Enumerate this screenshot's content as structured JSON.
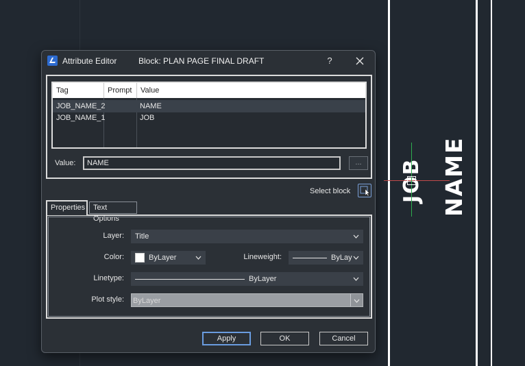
{
  "dialog": {
    "title": "Attribute Editor",
    "block_label": "Block: PLAN PAGE FINAL DRAFT",
    "help_label": "?"
  },
  "table": {
    "headers": {
      "tag": "Tag",
      "prompt": "Prompt",
      "value": "Value"
    },
    "rows": [
      {
        "tag": "JOB_NAME_2",
        "prompt": "",
        "value": "NAME"
      },
      {
        "tag": "JOB_NAME_1",
        "prompt": "",
        "value": "JOB"
      }
    ],
    "selected_row": 0
  },
  "value_field": {
    "label": "Value:",
    "value": "NAME",
    "browse_label": "..."
  },
  "select_block": {
    "label": "Select block",
    "icon": "select-block-icon"
  },
  "tabs": [
    {
      "label": "Properties",
      "active": true
    },
    {
      "label": "Text Options",
      "active": false
    }
  ],
  "properties": {
    "layer": {
      "label": "Layer:",
      "value": "Title"
    },
    "color": {
      "label": "Color:",
      "value": "ByLayer",
      "swatch": "#ffffff"
    },
    "lineweight": {
      "label": "Lineweight:",
      "value": "ByLay"
    },
    "linetype": {
      "label": "Linetype:",
      "value": "ByLayer"
    },
    "plot_style": {
      "label": "Plot style:",
      "value": "ByLayer",
      "disabled": true
    }
  },
  "buttons": {
    "apply": "Apply",
    "ok": "OK",
    "cancel": "Cancel"
  },
  "canvas": {
    "text_1": "JOB",
    "text_2": "NAME",
    "colors": {
      "background": "#212830",
      "accent": "#6a9ce0",
      "crosshair_x": "#c24b4b",
      "crosshair_y": "#2fae4f"
    }
  }
}
